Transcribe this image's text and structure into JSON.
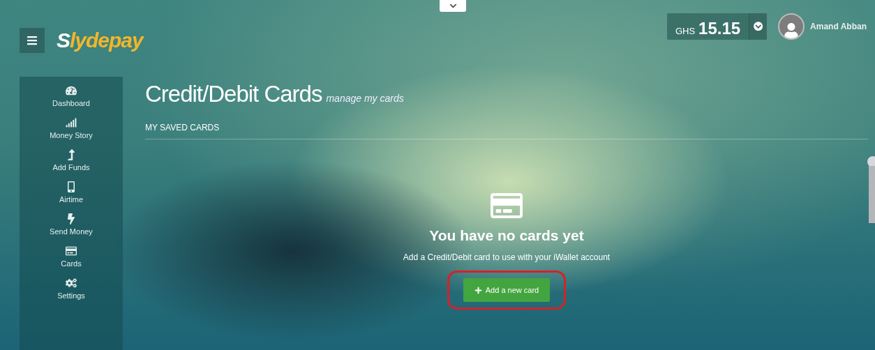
{
  "header": {
    "logo": "Slydepay",
    "balance": {
      "currency": "GHS",
      "amount": "15.15"
    },
    "user": {
      "name": "Amand Abban"
    }
  },
  "sidebar": {
    "items": [
      {
        "label": "Dashboard"
      },
      {
        "label": "Money Story"
      },
      {
        "label": "Add Funds"
      },
      {
        "label": "Airtime"
      },
      {
        "label": "Send Money"
      },
      {
        "label": "Cards"
      },
      {
        "label": "Settings"
      }
    ]
  },
  "page": {
    "title": "Credit/Debit Cards",
    "subtitle": "manage my cards",
    "section": "MY SAVED CARDS"
  },
  "empty_state": {
    "heading": "You have no cards yet",
    "text": "Add a Credit/Debit card to use with your iWallet account",
    "button": "Add a new card",
    "highlighted": true
  }
}
